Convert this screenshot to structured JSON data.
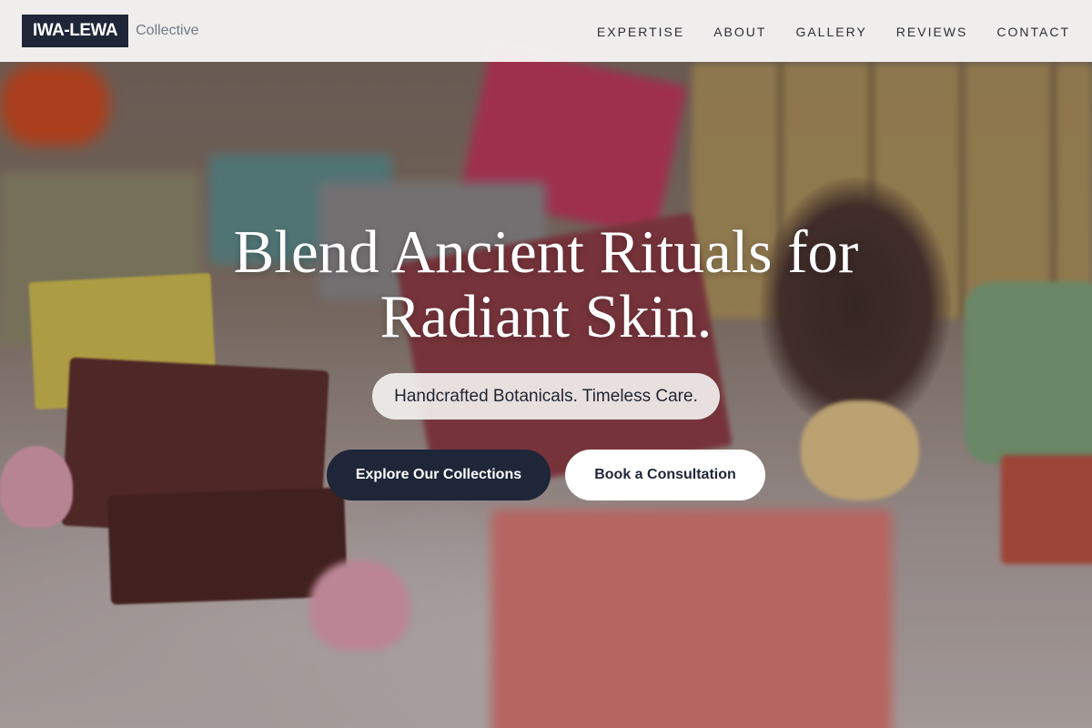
{
  "brand": {
    "logo": "IWA-LEWA",
    "subtitle": "Collective"
  },
  "nav": {
    "items": [
      {
        "label": "EXPERTISE"
      },
      {
        "label": "ABOUT"
      },
      {
        "label": "GALLERY"
      },
      {
        "label": "REVIEWS"
      },
      {
        "label": "CONTACT"
      }
    ]
  },
  "hero": {
    "headline_line1": "Blend Ancient Rituals for",
    "headline_line2": "Radiant Skin.",
    "tagline": "Handcrafted Botanicals. Timeless Care.",
    "primary_cta": "Explore Our Collections",
    "secondary_cta": "Book a Consultation",
    "background_image": "handmade-soap-bars-photo"
  },
  "colors": {
    "accent": "#1e2638",
    "header_bg": "#f8f7f5",
    "button_secondary_bg": "#ffffff"
  }
}
